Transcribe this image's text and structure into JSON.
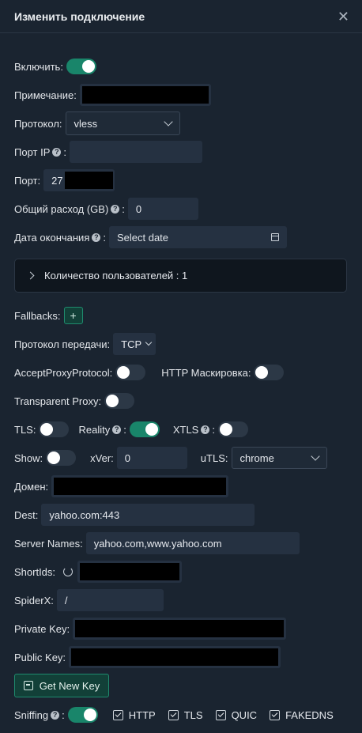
{
  "dialog": {
    "title": "Изменить подключение"
  },
  "enable": {
    "label": "Включить",
    "on": true
  },
  "remark": {
    "label": "Примечание",
    "value": ""
  },
  "protocol": {
    "label": "Протокол",
    "value": "vless"
  },
  "listen_ip": {
    "label": "Порт IP",
    "value": ""
  },
  "port": {
    "label": "Порт",
    "value": "27"
  },
  "total_flow": {
    "label": "Общий расход (GB)",
    "value": "0"
  },
  "expiry": {
    "label": "Дата окончания",
    "placeholder": "Select date"
  },
  "clients_panel": {
    "label": "Количество пользователей : 1"
  },
  "fallbacks": {
    "label": "Fallbacks",
    "add": "+"
  },
  "transport": {
    "label": "Протокол передачи",
    "value": "TCP"
  },
  "accept_proxy": {
    "label": "AcceptProxyProtocol",
    "on": false
  },
  "http_mask": {
    "label": "HTTP Маскировка",
    "on": false
  },
  "tproxy": {
    "label": "Transparent Proxy",
    "on": false
  },
  "tls": {
    "label": "TLS",
    "on": false
  },
  "reality": {
    "label": "Reality",
    "on": true
  },
  "xtls": {
    "label": "XTLS",
    "on": false
  },
  "show": {
    "label": "Show",
    "on": false
  },
  "xver": {
    "label": "xVer",
    "value": "0"
  },
  "utls": {
    "label": "uTLS",
    "value": "chrome"
  },
  "domain": {
    "label": "Домен",
    "value": ""
  },
  "dest": {
    "label": "Dest",
    "value": "yahoo.com:443"
  },
  "server_names": {
    "label": "Server Names",
    "value": "yahoo.com,www.yahoo.com"
  },
  "short_ids": {
    "label": "ShortIds",
    "value": ""
  },
  "spider_x": {
    "label": "SpiderX",
    "value": "/"
  },
  "private_key": {
    "label": "Private Key",
    "value": ""
  },
  "public_key": {
    "label": "Public Key",
    "value": ""
  },
  "get_key": {
    "label": "Get New Key"
  },
  "sniffing": {
    "label": "Sniffing",
    "on": true,
    "options": [
      "HTTP",
      "TLS",
      "QUIC",
      "FAKEDNS"
    ]
  }
}
